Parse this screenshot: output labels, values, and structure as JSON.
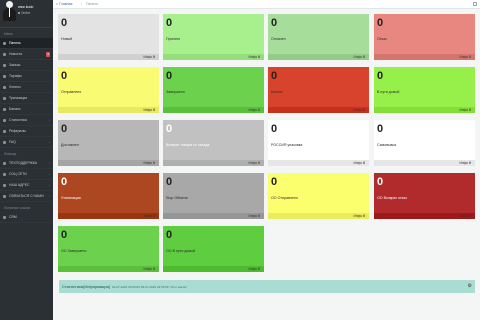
{
  "user": {
    "name": "wsw kudo",
    "status": "Online"
  },
  "sidebar": {
    "section_main": "Меню",
    "items": [
      {
        "label": "Панель",
        "active": true
      },
      {
        "label": "Новости",
        "badge": "2"
      },
      {
        "label": "Заказы"
      },
      {
        "label": "Тарифы"
      },
      {
        "label": "Логины"
      },
      {
        "label": "Транзакции"
      },
      {
        "label": "Баланс"
      },
      {
        "label": "Статистика",
        "caret": "‹"
      },
      {
        "label": "Рефералы"
      },
      {
        "label": "FAQ",
        "caret": "‹"
      }
    ],
    "section_help": "Помощь",
    "help_items": [
      {
        "label": "ТЕХПОДДЕРЖКА",
        "caret": "‹"
      },
      {
        "label": "СОЦ СЕТИ",
        "caret": "‹"
      },
      {
        "label": "НАШ АДРЕС",
        "caret": "‹"
      },
      {
        "label": "СВЯЗАТЬСЯ С НАМИ",
        "caret": "‹"
      }
    ],
    "section_extra": "Полезные ссылки",
    "extra_items": [
      {
        "label": "CRM"
      }
    ]
  },
  "breadcrumb": {
    "home": "Главная",
    "current": "Панель"
  },
  "info_label": "Инфо",
  "tiles": [
    {
      "value": "0",
      "label": "Новый",
      "bg": "#e3e3e3",
      "foot": "#d0d0d0"
    },
    {
      "value": "0",
      "label": "Принято",
      "bg": "#a8f08e",
      "foot": "#96de7c"
    },
    {
      "value": "0",
      "label": "Оплачен",
      "bg": "#a7dd9a",
      "foot": "#95cb88"
    },
    {
      "value": "0",
      "label": "Отказ",
      "bg": "#e8877f",
      "foot": "#d6756d"
    },
    {
      "value": "0",
      "label": "Отправлено",
      "bg": "#f9fb73",
      "foot": "#e7e961"
    },
    {
      "value": "0",
      "label": "Завершено",
      "bg": "#6cd24e",
      "foot": "#5ac03c"
    },
    {
      "value": "0",
      "label": "Клиент",
      "bg": "#d8432d",
      "foot": "#c6311b"
    },
    {
      "value": "0",
      "label": "В пути домой",
      "bg": "#97f04a",
      "foot": "#85de38"
    },
    {
      "value": "0",
      "label": "Доставлен",
      "bg": "#b7b7b7",
      "foot": "#a5a5a5"
    },
    {
      "value": "0",
      "label": "Возврат товара со склада",
      "bg": "#c1c1c1",
      "foot": "#afafaf"
    },
    {
      "value": "0",
      "label": "РОССИЯ упаковка",
      "bg": "#ffffff",
      "foot": "#e6e6e6"
    },
    {
      "value": "0",
      "label": "Самовывоз",
      "bg": "#ffffff",
      "foot": "#e6e6e6"
    },
    {
      "value": "0",
      "label": "Утилизация",
      "bg": "#ad4722",
      "foot": "#9b3510"
    },
    {
      "value": "0",
      "label": "Stop Обмена",
      "bg": "#a8a8a8",
      "foot": "#969696"
    },
    {
      "value": "0",
      "label": "ОО Отправлено",
      "bg": "#fbff6e",
      "foot": "#e9ed5c"
    },
    {
      "value": "0",
      "label": "ОО Возврат отказ",
      "bg": "#b12a2c",
      "foot": "#9f181a"
    },
    {
      "value": "0",
      "label": "ОО Завершено",
      "bg": "#6cd24e",
      "foot": "#5ac03c"
    },
    {
      "value": "0",
      "label": "ОО В пути домой",
      "bg": "#5fcd40",
      "foot": "#4dbb2e"
    }
  ],
  "stats": {
    "title": "Статистика(Информация)",
    "subtitle": "01-07-2020 00:00:00 09-07-2020 23:59:59 \"Этот месяц\""
  }
}
